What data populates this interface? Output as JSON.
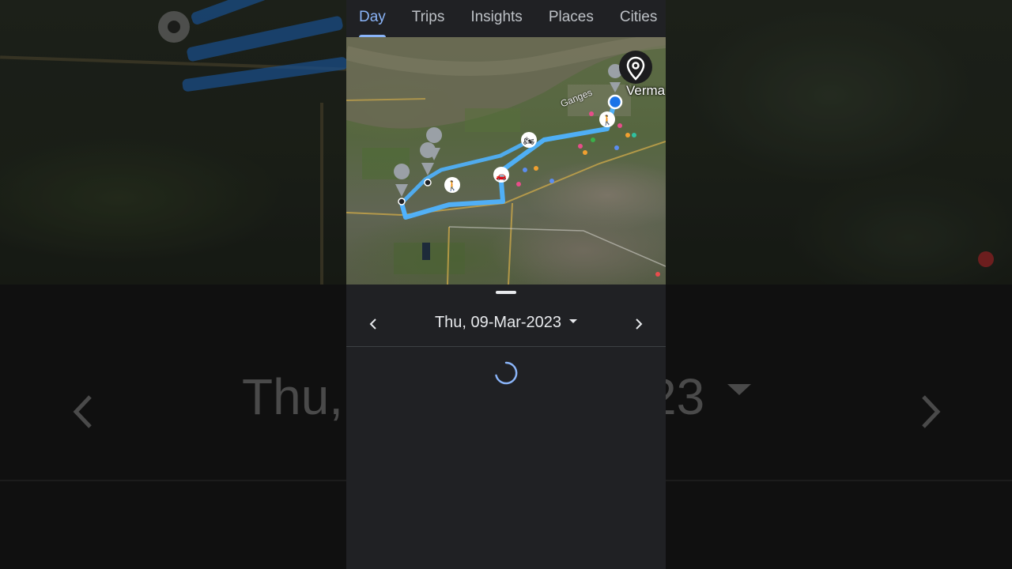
{
  "tabs": [
    {
      "label": "Day",
      "active": true
    },
    {
      "label": "Trips",
      "active": false
    },
    {
      "label": "Insights",
      "active": false
    },
    {
      "label": "Places",
      "active": false
    },
    {
      "label": "Cities",
      "active": false
    }
  ],
  "map": {
    "place_label": "Verma",
    "river_label": "Ganges",
    "route_color": "#4fb3ff"
  },
  "date_nav": {
    "date": "Thu, 09-Mar-2023",
    "prev_icon": "chevron-left-icon",
    "next_icon": "chevron-right-icon",
    "dropdown_icon": "caret-down-icon"
  },
  "background": {
    "date_fragment_left": "Thu,",
    "date_fragment_right": "23"
  },
  "status": {
    "loading": true
  },
  "colors": {
    "accent": "#8ab4f8",
    "panel_bg": "#202124",
    "text": "#e8eaed"
  }
}
